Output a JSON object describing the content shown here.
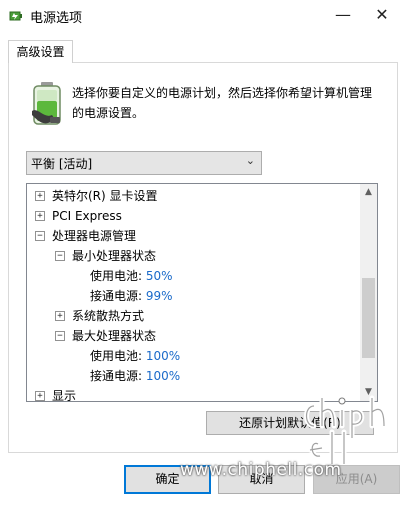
{
  "window": {
    "title": "电源选项",
    "minimize_glyph": "—",
    "close_glyph": "✕"
  },
  "tab": {
    "label": "高级设置"
  },
  "description": "选择你要自定义的电源计划，然后选择你希望计算机管理的电源设置。",
  "plan_dropdown": {
    "selected": "平衡 [活动]"
  },
  "tree": [
    {
      "label": "英特尔(R) 显卡设置",
      "expander": "+"
    },
    {
      "label": "PCI Express",
      "expander": "+"
    },
    {
      "label": "处理器电源管理",
      "expander": "−"
    },
    {
      "label": "最小处理器状态",
      "expander": "−"
    },
    {
      "label": "使用电池:",
      "value": "50%"
    },
    {
      "label": "接通电源:",
      "value": "99%"
    },
    {
      "label": "系统散热方式",
      "expander": "+"
    },
    {
      "label": "最大处理器状态",
      "expander": "−"
    },
    {
      "label": "使用电池:",
      "value": "100%"
    },
    {
      "label": "接通电源:",
      "value": "100%"
    },
    {
      "label": "显示",
      "expander": "+"
    }
  ],
  "restore_button": "还原计划默认值(R)",
  "buttons": {
    "ok": "确定",
    "cancel": "取消",
    "apply": "应用(A)"
  },
  "watermark": {
    "url": "www.chiphell.com"
  },
  "colors": {
    "value_text": "#1a6ac9",
    "focus_border": "#0078d7"
  }
}
